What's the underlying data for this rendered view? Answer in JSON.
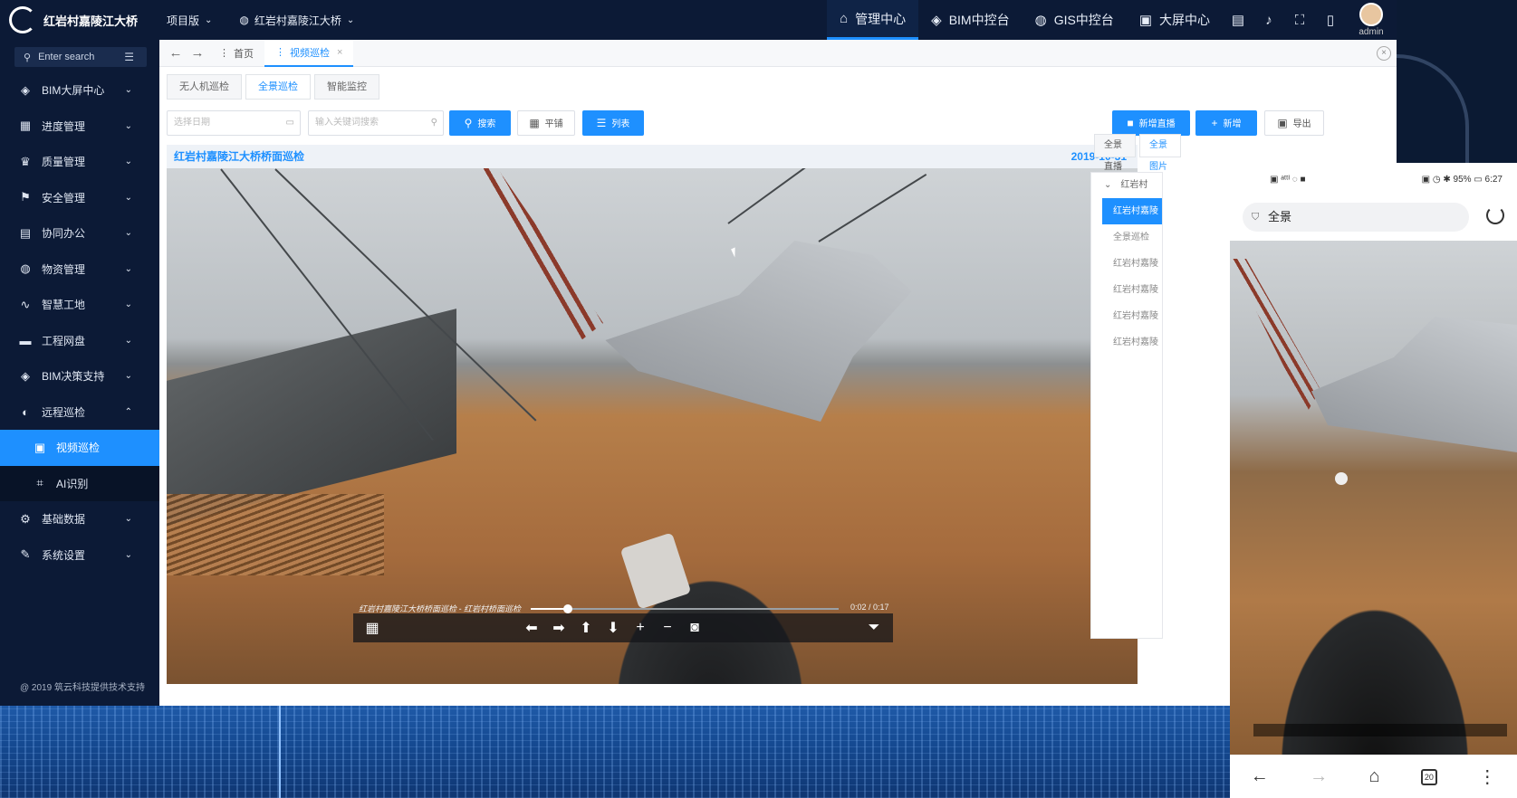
{
  "app": {
    "title": "红岩村嘉陵江大桥"
  },
  "top": {
    "project_label": "项目版",
    "bridge_label": "红岩村嘉陵江大桥",
    "nav": [
      {
        "label": "管理中心",
        "icon": "home-icon"
      },
      {
        "label": "BIM中控台",
        "icon": "cube-icon"
      },
      {
        "label": "GIS中控台",
        "icon": "globe-icon"
      },
      {
        "label": "大屏中心",
        "icon": "chart-icon"
      }
    ],
    "user": "admin"
  },
  "sidebar": {
    "search_placeholder": "Enter search",
    "items": [
      {
        "label": "BIM大屏中心",
        "icon": "cube-icon"
      },
      {
        "label": "进度管理",
        "icon": "grid-icon"
      },
      {
        "label": "质量管理",
        "icon": "trophy-icon"
      },
      {
        "label": "安全管理",
        "icon": "flag-icon"
      },
      {
        "label": "协同办公",
        "icon": "document-icon"
      },
      {
        "label": "物资管理",
        "icon": "globe-icon"
      },
      {
        "label": "智慧工地",
        "icon": "pulse-icon"
      },
      {
        "label": "工程网盘",
        "icon": "folder-icon"
      },
      {
        "label": "BIM决策支持",
        "icon": "cube-icon"
      },
      {
        "label": "远程巡检",
        "icon": "half-circle-icon"
      }
    ],
    "subitems": [
      {
        "label": "视频巡检",
        "icon": "video-icon"
      },
      {
        "label": "AI识别",
        "icon": "crop-icon"
      }
    ],
    "items_after": [
      {
        "label": "基础数据",
        "icon": "gear-icon"
      },
      {
        "label": "系统设置",
        "icon": "pencil-icon"
      }
    ],
    "footer": "@ 2019 筑云科技提供技术支持"
  },
  "tabs": {
    "home": "首页",
    "current": "视频巡检"
  },
  "subtabs": [
    "无人机巡检",
    "全景巡检",
    "智能监控"
  ],
  "toolbar": {
    "date_placeholder": "选择日期",
    "keyword_placeholder": "输入关键词搜索",
    "search": "搜索",
    "tile": "平铺",
    "list": "列表",
    "new_live": "新增直播",
    "add": "新增",
    "export": "导出"
  },
  "viewer": {
    "title": "红岩村嘉陵江大桥桥面巡检",
    "date": "2019-10-31",
    "caption": "红岩村嘉陵江大桥桥面巡检 - 红岩村桥面巡检",
    "time": "0:02 / 0:17",
    "progress": 0.12
  },
  "right_panel": {
    "tabs": [
      "全景直播",
      "全景图片"
    ],
    "group": "红岩村",
    "items": [
      "红岩村嘉陵",
      "全景巡检",
      "红岩村嘉陵",
      "红岩村嘉陵",
      "红岩村嘉陵",
      "红岩村嘉陵"
    ]
  },
  "phone": {
    "status_left": "▣ ᵃᵗᵗᴵ ◌ ■",
    "status_right": "▣ ◷ ✱ 95% ▭ 6:27",
    "url": "全景",
    "tab_count": "20"
  }
}
